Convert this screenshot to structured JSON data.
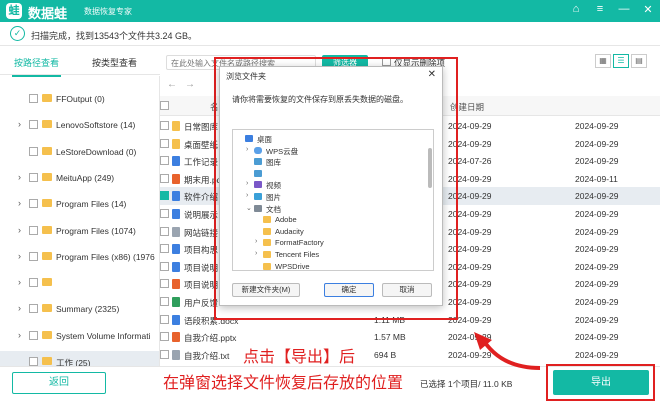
{
  "app": {
    "logo": "蛙",
    "name": "数据蛙",
    "subtitle": "数据恢复专家"
  },
  "window_buttons": {
    "theme": "⌂",
    "menu": "≡",
    "minimize": "—",
    "close": "✕"
  },
  "status": {
    "text": "扫描完成，找到13543个文件共3.24 GB。"
  },
  "tabs": [
    {
      "label": "按路径查看",
      "active": true
    },
    {
      "label": "按类型查看",
      "active": false
    }
  ],
  "tree": [
    {
      "label": "FFOutput (0)",
      "expandable": false
    },
    {
      "label": "LenovoSoftstore (14)",
      "expandable": true
    },
    {
      "label": "LeStoreDownload (0)",
      "expandable": false
    },
    {
      "label": "MeituApp (249)",
      "expandable": true
    },
    {
      "label": "Program Files (14)",
      "expandable": true
    },
    {
      "label": "Program Files (1074)",
      "expandable": true
    },
    {
      "label": "Program Files (x86) (1976",
      "expandable": true
    },
    {
      "label": "",
      "expandable": true,
      "blurred": true
    },
    {
      "label": "Summary (2325)",
      "expandable": true
    },
    {
      "label": "System Volume Informati",
      "expandable": true
    },
    {
      "label": "工作 (25)",
      "expandable": false,
      "selected": true
    }
  ],
  "toolbar": {
    "search_placeholder": "在此处输入文件名或路径搜索",
    "filter_label": "筛选器",
    "show_deleted_label": "仅显示删除项",
    "nav_back": "←",
    "nav_forward": "→"
  },
  "columns": {
    "name": "名",
    "created": "创建日期"
  },
  "files": [
    {
      "name": "日常图库",
      "size": "",
      "created": "2024-09-29",
      "modified": "2024-09-29",
      "type": "img"
    },
    {
      "name": "桌面壁纸",
      "size": "",
      "created": "2024-09-29",
      "modified": "2024-09-29",
      "type": "img"
    },
    {
      "name": "工作记录",
      "size": "",
      "created": "2024-07-26",
      "modified": "2024-09-29",
      "type": "doc"
    },
    {
      "name": "期末用.pd",
      "size": "",
      "created": "2024-09-29",
      "modified": "2024-09-11",
      "type": "ppt"
    },
    {
      "name": "软件介绍",
      "size": "",
      "created": "2024-09-29",
      "modified": "2024-09-29",
      "type": "doc",
      "selected": true
    },
    {
      "name": "说明展示",
      "size": "",
      "created": "2024-09-29",
      "modified": "2024-09-29",
      "type": "doc"
    },
    {
      "name": "网站链接",
      "size": "",
      "created": "2024-09-29",
      "modified": "2024-09-29",
      "type": "txt"
    },
    {
      "name": "项目构思",
      "size": "",
      "created": "2024-09-29",
      "modified": "2024-09-29",
      "type": "doc"
    },
    {
      "name": "项目说明",
      "size": "",
      "created": "2024-09-29",
      "modified": "2024-09-29",
      "type": "doc"
    },
    {
      "name": "项目说明",
      "size": "",
      "created": "2024-09-29",
      "modified": "2024-09-29",
      "type": "ppt"
    },
    {
      "name": "用户反馈",
      "size": "",
      "created": "2024-09-29",
      "modified": "2024-09-29",
      "type": "xls"
    },
    {
      "name": "语段积累.docx",
      "size": "1.11 MB",
      "created": "2024-09-29",
      "modified": "2024-09-29",
      "type": "doc"
    },
    {
      "name": "自我介绍.pptx",
      "size": "1.57 MB",
      "created": "2024-09-29",
      "modified": "2024-09-29",
      "type": "ppt"
    },
    {
      "name": "自我介绍.txt",
      "size": "694 B",
      "created": "2024-09-29",
      "modified": "2024-09-29",
      "type": "txt"
    }
  ],
  "dialog": {
    "title": "浏览文件夹",
    "close": "✕",
    "message": "请你将需要恢复的文件保存到原丢失数据的磁盘。",
    "folders": [
      {
        "label": "桌面",
        "indent": 0,
        "expander": "",
        "icon": "blue"
      },
      {
        "label": "WPS云盘",
        "indent": 1,
        "expander": "›",
        "icon": "cloud"
      },
      {
        "label": "图库",
        "indent": 1,
        "expander": "",
        "icon": "pic"
      },
      {
        "label": "",
        "indent": 1,
        "expander": "",
        "icon": "pic",
        "blurred": true
      },
      {
        "label": "视频",
        "indent": 1,
        "expander": "›",
        "icon": "video"
      },
      {
        "label": "图片",
        "indent": 1,
        "expander": "›",
        "icon": "pics"
      },
      {
        "label": "文档",
        "indent": 1,
        "expander": "⌄",
        "icon": "docs"
      },
      {
        "label": "Adobe",
        "indent": 2,
        "expander": "",
        "icon": "fold"
      },
      {
        "label": "Audacity",
        "indent": 2,
        "expander": "",
        "icon": "fold"
      },
      {
        "label": "FormatFactory",
        "indent": 2,
        "expander": "›",
        "icon": "fold"
      },
      {
        "label": "Tencent Files",
        "indent": 2,
        "expander": "›",
        "icon": "fold"
      },
      {
        "label": "WPSDrive",
        "indent": 2,
        "expander": "",
        "icon": "fold"
      }
    ],
    "new_folder": "新建文件夹(M)",
    "ok": "确定",
    "cancel": "取消"
  },
  "annotation": {
    "line1": "点击【导出】后",
    "line2": "在弹窗选择文件恢复后存放的位置",
    "color": "#e02020"
  },
  "bottom": {
    "back": "返回",
    "selection_info": "已选择 1个项目/ 11.0 KB",
    "export": "导出"
  },
  "colors": {
    "accent": "#13b9a4",
    "highlight": "#e02020"
  }
}
